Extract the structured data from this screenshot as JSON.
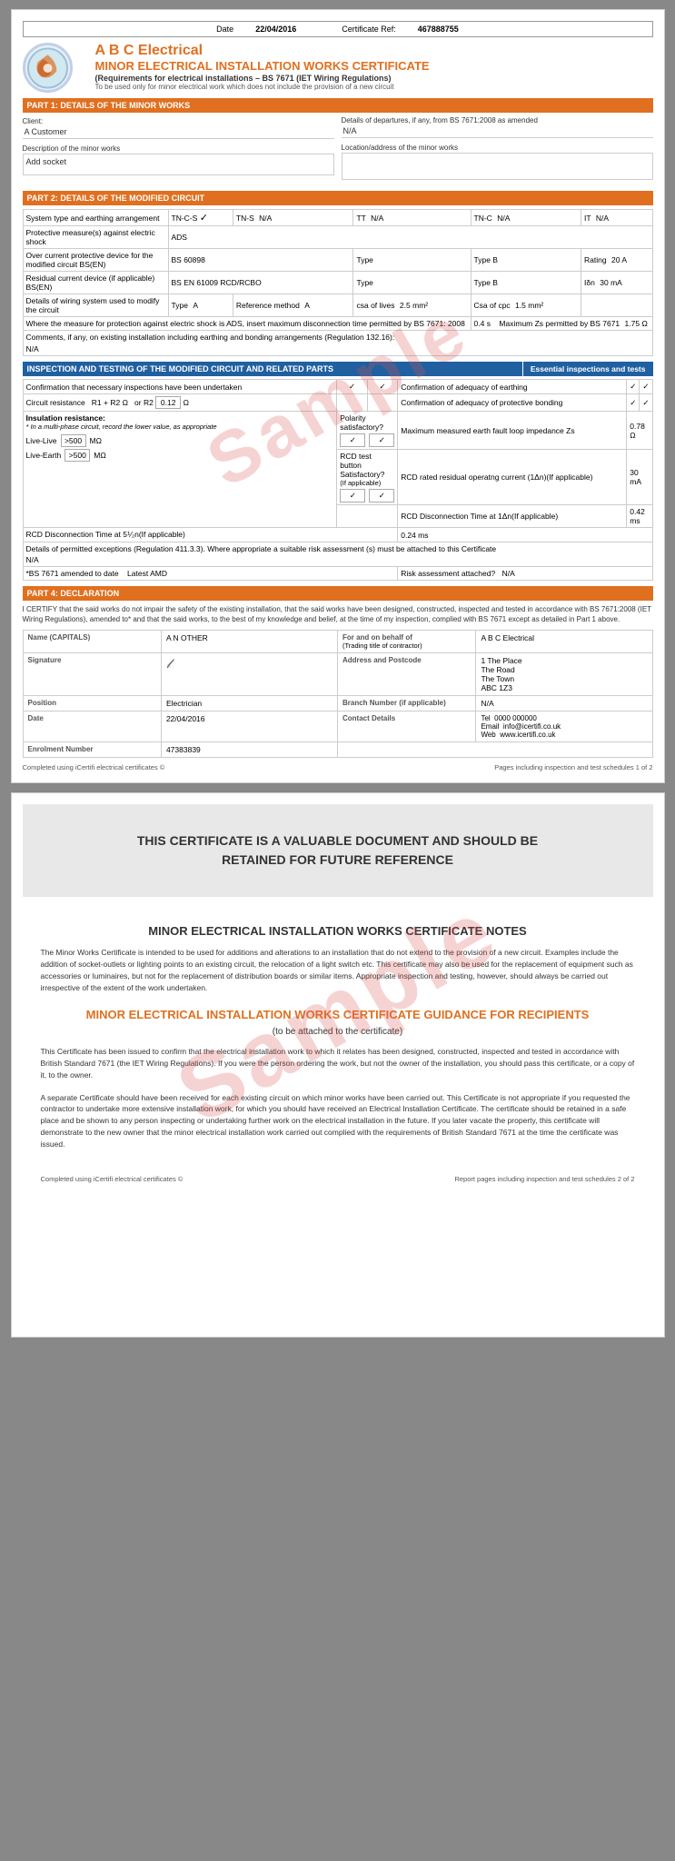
{
  "page1": {
    "date_label": "Date",
    "date_value": "22/04/2016",
    "cert_ref_label": "Certificate Ref:",
    "cert_ref_value": "467888755",
    "company_name": "A B C Electrical",
    "cert_title": "MINOR ELECTRICAL INSTALLATION WORKS CERTIFICATE",
    "cert_subtitle": "(Requirements for electrical installations – BS 7671 (IET Wiring Regulations)",
    "cert_subtitle2": "To be used only for minor electrical work which does not include the provision of a new circuit",
    "part1_title": "PART 1: DETAILS OF THE MINOR WORKS",
    "departures_label": "Details of departures, if any, from BS 7671:2008 as amended",
    "departures_value": "N/A",
    "client_label": "Client:",
    "client_value": "A Customer",
    "desc_label": "Description of the minor works",
    "desc_value": "Add socket",
    "location_label": "Location/address of the minor works",
    "location_value": "",
    "part2_title": "PART 2: DETAILS OF THE MODIFIED CIRCUIT",
    "system_label": "System type and earthing arrangement",
    "system_tncs": "TN-C-S",
    "system_tncs_tick": "✓",
    "system_tns": "TN-S",
    "system_tns_val": "N/A",
    "system_tt": "TT",
    "system_tt_val": "N/A",
    "system_tnc": "TN-C",
    "system_tnc_val": "N/A",
    "system_it": "IT",
    "system_it_val": "N/A",
    "protective_label": "Protective measure(s) against electric shock",
    "protective_value": "ADS",
    "overcurrent_label": "Over current protective device for the modified circuit BS(EN)",
    "overcurrent_value": "BS 60898",
    "type_label": "Type",
    "type_value": "Type B",
    "rating_label": "Rating",
    "rating_value": "20",
    "rating_unit": "A",
    "rcd_label": "Residual current device (if applicable) BS(EN)",
    "rcd_value": "BS EN 61009 RCD/RCBO",
    "rcd_type_label": "Type",
    "rcd_type_value": "Type B",
    "rcd_ion_label": "Iδn",
    "rcd_ion_value": "30",
    "rcd_ion_unit": "mA",
    "wiring_label": "Details of wiring system used to modify the circuit",
    "wiring_type_label": "Type",
    "wiring_type_value": "A",
    "wiring_ref_label": "Reference method",
    "wiring_ref_value": "A",
    "wiring_csa_label": "csa of lives",
    "wiring_csa_value": "2.5",
    "wiring_csa_unit": "mm²",
    "wiring_cpc_label": "Csa of cpc",
    "wiring_cpc_value": "1.5",
    "wiring_cpc_unit": "mm²",
    "protection_label": "Where the measure for protection against electric shock is ADS, insert maximum disconnection time permitted by BS 7671: 2008",
    "protection_value": "0.4",
    "protection_unit": "s",
    "max_zs_label": "Maximum Zs permitted by BS 7671",
    "max_zs_value": "1.75",
    "max_zs_unit": "Ω",
    "comments_label": "Comments, if any, on existing installation including earthing and bonding arrangements (Regulation 132.16):",
    "comments_value": "N/A",
    "part3_title": "INSPECTION AND TESTING OF THE MODIFIED CIRCUIT AND RELATED PARTS",
    "essential_label": "Essential inspections and tests",
    "confirm_inspections_label": "Confirmation that necessary inspections have been undertaken",
    "confirm_inspections_tick1": "✓",
    "confirm_inspections_tick2": "✓",
    "confirm_earthing_label": "Confirmation of adequacy of earthing",
    "confirm_earthing_tick1": "✓",
    "confirm_earthing_tick2": "✓",
    "circuit_resistance_label": "Circuit resistance",
    "r1r2_label": "R1 + R2",
    "r1r2_unit": "Ω",
    "or_label": "or R2",
    "r2_value": "0.12",
    "r2_unit": "Ω",
    "confirm_bonding_label": "Confirmation of adequacy of protective bonding",
    "confirm_bonding_tick1": "✓",
    "confirm_bonding_tick2": "✓",
    "insulation_label": "Insulation resistance:",
    "insulation_note": "* In a multi-phase circuit, record the lower value, as appropriate",
    "polarity_label": "Polarity satisfactory?",
    "polarity_tick1": "✓",
    "polarity_tick2": "✓",
    "rcd_test_label": "RCD test button Satisfactory?",
    "rcd_test_sub": "(If applicable)",
    "rcd_test_tick1": "✓",
    "rcd_test_tick2": "✓",
    "max_earth_label": "Maximum measured earth fault loop impedance Zs",
    "max_earth_value": "0.78",
    "max_earth_unit": "Ω",
    "rcd_rated_label": "RCD rated residual operatng current (1Δn)(If applicable)",
    "rcd_rated_value": "30",
    "rcd_rated_unit": "mA",
    "live_live_label": "Live-Live",
    "live_live_value": ">500",
    "live_live_unit": "MΩ",
    "live_earth_label": "Live-Earth",
    "live_earth_value": ">500",
    "live_earth_unit": "MΩ",
    "rcd_disc_1_label": "RCD Disconnection Time at 1Δn(If applicable)",
    "rcd_disc_1_value": "0.42",
    "rcd_disc_1_unit": "ms",
    "rcd_disc_5_label": "RCD Disconnection Time at 5⅟₂n(If applicable)",
    "rcd_disc_5_value": "0.24",
    "rcd_disc_5_unit": "ms",
    "details_permitted_label": "Details of permitted exceptions (Regulation 411.3.3). Where appropriate a suitable risk assessment (s) must be attached to this Certificate",
    "details_permitted_value": "N/A",
    "bs7671_label": "*BS 7671 amended to date",
    "latest_amd_label": "Latest AMD",
    "risk_label": "Risk assessment attached?",
    "risk_value": "N/A",
    "part4_title": "PART 4: DECLARATION",
    "declaration_text": "I CERTIFY that the said works do not impair the safety of the existing installation, that the said works have been designed, constructed, inspected and tested in accordance with BS 7671:2008 (IET Wiring Regulations), amended to* and that the said works, to the best of my knowledge and belief, at the time of my inspection, complied with BS 7671 except as detailed in Part 1 above.",
    "name_label": "Name (CAPITALS)",
    "name_value": "A N OTHER",
    "behalf_label": "For and on behalf of",
    "behalf_sub": "(Trading title of contractor)",
    "behalf_value": "A B C Electrical",
    "signature_label": "Signature",
    "address_label": "Address and Postcode",
    "address_value": "1 The Place\nThe Road\nThe Town\nABC 1Z3",
    "position_label": "Position",
    "position_value": "Electrician",
    "branch_label": "Branch Number (if applicable)",
    "branch_value": "N/A",
    "date_label2": "Date",
    "date_value2": "22/04/2016",
    "contact_label": "Contact Details",
    "tel_label": "Tel",
    "tel_value": "0000 000000",
    "email_label": "Email",
    "email_value": "info@icertifi.co.uk",
    "web_label": "Web",
    "web_value": "www.icertifi.co.uk",
    "enrolment_label": "Enrolment Number",
    "enrolment_value": "47383839",
    "footer_left": "Completed using iCertifi electrical certificates ©",
    "footer_right": "Pages including inspection and test schedules 1 of 2"
  },
  "page2": {
    "banner_text": "THIS CERTIFICATE IS A VALUABLE DOCUMENT AND SHOULD BE\nRETAINED FOR FUTURE REFERENCE",
    "notes_title": "MINOR ELECTRICAL INSTALLATION WORKS CERTIFICATE NOTES",
    "notes_body": "The Minor Works Certificate is intended to be used for additions and alterations to an installation that do not extend to the provision of a new circuit. Examples include the addition of socket-outlets or lighting points to an existing circuit, the relocation of a light switch etc. This certificate may also be used for the replacement of equipment such as accessories or luminaires, but not for the replacement of distribution boards or similar items. Appropriate inspection and testing, however, should always be carried out irrespective of the extent of the work undertaken.",
    "guidance_title": "MINOR ELECTRICAL INSTALLATION WORKS CERTIFICATE GUIDANCE FOR RECIPIENTS",
    "guidance_sub": "(to be attached to the certificate)",
    "guidance_body1": "This Certificate has been issued to confirm that the electrical installation work to which it relates has been designed, constructed, inspected and tested in accordance with British Standard 7671 (the IET Wiring Regulations). If you were the person ordering the work, but not the owner of the installation, you should pass this certificate, or a copy of it, to the owner.",
    "guidance_body2": "A separate Certificate should have been received for each existing circuit on which minor works have been carried out. This Certificate is not appropriate if you requested the contractor to undertake more extensive installation work, for which you should have received an Electrical Installation Certificate. The certificate should be retained in a safe place and be shown to any person inspecting or undertaking further work on the electrical installation in the future. If you later vacate the property, this certificate will demonstrate to the new owner that the minor electrical installation work carried out complied with the requirements of British Standard 7671 at the time the certificate was issued.",
    "footer_left": "Completed using iCertifi electrical certificates ©",
    "footer_right": "Report pages including inspection and test schedules 2 of 2",
    "sample_text": "Sample"
  }
}
